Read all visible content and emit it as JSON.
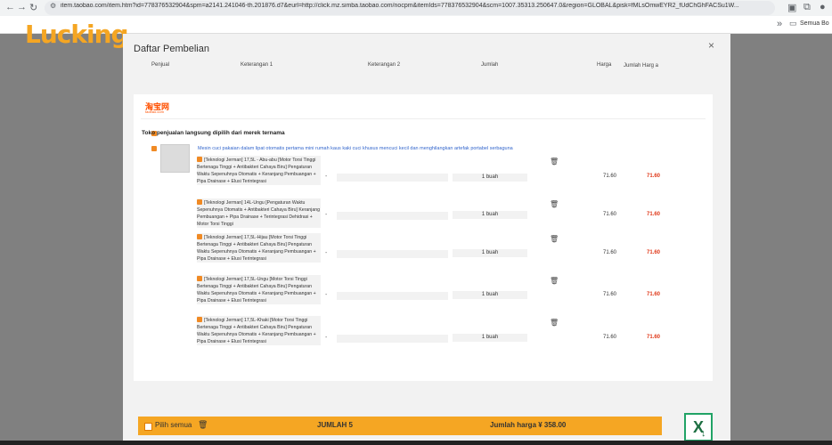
{
  "browser": {
    "url": "item.taobao.com/item.htm?id=778376532904&spm=a2141.241046-th.201876.d7&eurl=http://click.mz.simba.taobao.com/nocpm&itemIds=778376532904&scm=1007.35313.250647.0&region=GLOBAL&pisk=fMLsOmwEYR2_fUdChGhFACSu1W...",
    "bookmarks_label": "Semua Bo"
  },
  "logo": {
    "text": "Lucking"
  },
  "modal": {
    "title": "Daftar Pembelian",
    "close_label": "×",
    "columns": [
      "Penjual",
      "Keterangan 1",
      "Keterangan 2",
      "Jumlah",
      "Harga",
      "Jumlah Harg a"
    ]
  },
  "store": {
    "brand": "淘宝网",
    "brand_sub": "taobao.com",
    "name": "Toko penjualan langsung dipilih dari merek ternama",
    "promo_text": "Mesin cuci pakaian dalam lipat otomatis pertama mini rumah kaus kaki cuci khusus mencuci kecil dan menghilangkan artefak portabel serbaguna"
  },
  "items": [
    {
      "desc": "[Teknologi Jerman] 17,5L - Abu-abu [Motor Torsi Tinggi Bertenaga Tinggi + Antibakteri Cahaya Biru] Pengaturan Waktu Sepenuhnya Otomatis + Keranjang Pembuangan + Pipa Drainase + Elusi Terintegrasi",
      "note1": "-",
      "qty": "1 buah",
      "price": "71.60",
      "total": "71.60"
    },
    {
      "desc": "[Teknologi Jerman] 14L-Ungu [Pengaturan Waktu Sepenuhnya Otomatis + Antibakteri Cahaya Biru] Keranjang Pembuangan + Pipa Drainase + Terintegrasi Dehidrasi + Motor Torsi Tinggi",
      "note1": "-",
      "qty": "1 buah",
      "price": "71.60",
      "total": "71.60"
    },
    {
      "desc": "[Teknologi Jerman] 17,5L-Hijau [Motor Torsi Tinggi Bertenaga Tinggi + Antibakteri Cahaya Biru] Pengaturan Waktu Sepenuhnya Otomatis + Keranjang Pembuangan + Pipa Drainase + Elusi Terintegrasi",
      "note1": "-",
      "qty": "1 buah",
      "price": "71.60",
      "total": "71.60"
    },
    {
      "desc": "[Teknologi Jerman] 17,5L-Ungu [Motor Torsi Tinggi Bertenaga Tinggi + Antibakteri Cahaya Biru] Pengaturan Waktu Sepenuhnya Otomatis + Keranjang Pembuangan + Pipa Drainase + Elusi Terintegrasi",
      "note1": "-",
      "qty": "1 buah",
      "price": "71.60",
      "total": "71.60"
    },
    {
      "desc": "[Teknologi Jerman] 17,5L-Khaki [Motor Torsi Tinggi Bertenaga Tinggi + Antibakteri Cahaya Biru] Pengaturan Waktu Sepenuhnya Otomatis + Keranjang Pembuangan + Pipa Drainase + Elusi Terintegrasi",
      "note1": "-",
      "qty": "1 buah",
      "price": "71.60",
      "total": "71.60"
    }
  ],
  "footer": {
    "select_all": "Pilih semua",
    "count": "JUMLAH 5",
    "sum": "Jumlah harga ¥ 358.00"
  },
  "colors": {
    "accent": "#f5a623",
    "price_red": "#e0391a",
    "excel_green": "#21a366"
  }
}
